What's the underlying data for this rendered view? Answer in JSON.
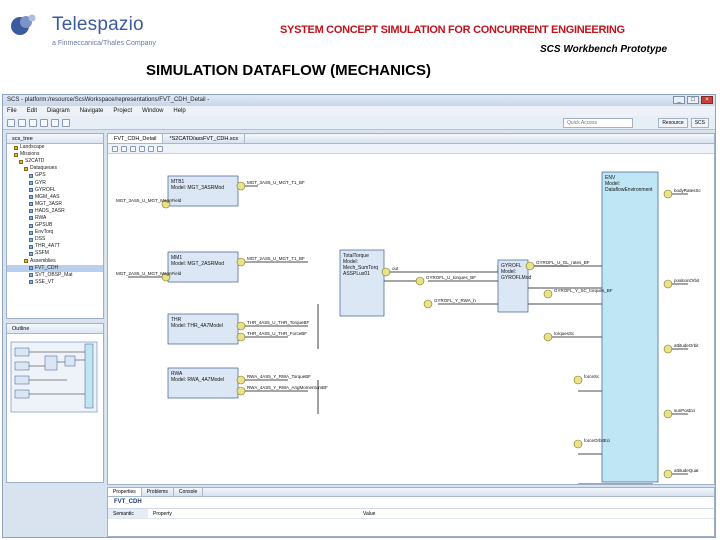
{
  "header": {
    "brand": "Telespazio",
    "brand_sub": "a Finmeccanica/Thales Company",
    "title": "SYSTEM CONCEPT SIMULATION FOR CONCURRENT ENGINEERING",
    "subtitle": "SCS Workbench Prototype",
    "slide_title": "SIMULATION DATAFLOW (MECHANICS)",
    "brand_color": "#3c5aa0",
    "title_color": "#c0121c"
  },
  "window": {
    "title": "SCS - platform:/resource/ScsWorkspace/representations/FVT_CDH_Detail -",
    "menu": [
      "File",
      "Edit",
      "Diagram",
      "Navigate",
      "Project",
      "Window",
      "Help"
    ],
    "quick_access": "Quick Access",
    "perspectives": [
      "Resource",
      "SCS"
    ]
  },
  "tree_panel": {
    "tab": "scs_tree",
    "items": [
      {
        "label": "Landscape",
        "depth": 1,
        "leaf": false
      },
      {
        "label": "Missions",
        "depth": 1,
        "leaf": false
      },
      {
        "label": "S2CATD",
        "depth": 2,
        "leaf": false
      },
      {
        "label": "Dataqueues",
        "depth": 3,
        "leaf": false
      },
      {
        "label": "GPS",
        "depth": 4,
        "leaf": true
      },
      {
        "label": "GYR",
        "depth": 4,
        "leaf": true
      },
      {
        "label": "GYROFL",
        "depth": 4,
        "leaf": true
      },
      {
        "label": "MGM_4AS",
        "depth": 4,
        "leaf": true
      },
      {
        "label": "MGT_3ASR",
        "depth": 4,
        "leaf": true
      },
      {
        "label": "HADS_2ASR",
        "depth": 4,
        "leaf": true
      },
      {
        "label": "RWA",
        "depth": 4,
        "leaf": true
      },
      {
        "label": "GPSUB",
        "depth": 4,
        "leaf": true
      },
      {
        "label": "EnvTorq",
        "depth": 4,
        "leaf": true
      },
      {
        "label": "DSS",
        "depth": 4,
        "leaf": true
      },
      {
        "label": "THR_4A7T",
        "depth": 4,
        "leaf": true
      },
      {
        "label": "SSFM",
        "depth": 4,
        "leaf": true
      },
      {
        "label": "Assemblies",
        "depth": 3,
        "leaf": false
      },
      {
        "label": "FVT_CDH",
        "depth": 4,
        "leaf": true,
        "selected": true
      },
      {
        "label": "SVT_OBSP_Mat",
        "depth": 4,
        "leaf": true
      },
      {
        "label": "SSE_VT",
        "depth": 4,
        "leaf": true
      }
    ]
  },
  "outline_panel": {
    "tab": "Outline"
  },
  "editor": {
    "tabs": [
      "FVT_CDH_Detail",
      "*S2CATD/assFVT_CDH.scs"
    ],
    "active_tab": 0
  },
  "diagram": {
    "blocks": [
      {
        "id": "mtb",
        "lines": [
          "MTB1",
          "Model: MGT_3ASRMod"
        ]
      },
      {
        "id": "mgm",
        "lines": [
          "MM1",
          "Model: MGT_2ASRMod"
        ]
      },
      {
        "id": "thr",
        "lines": [
          "THR",
          "Model: THR_4A7Model"
        ]
      },
      {
        "id": "rwa",
        "lines": [
          "RWA",
          "Model: RWA_4A7Model"
        ]
      },
      {
        "id": "total",
        "lines": [
          "TotalTorque",
          "Model:",
          "Mech_SumTorq",
          "ASSPLus01"
        ]
      },
      {
        "id": "gyro",
        "lines": [
          "GYROFL",
          "Model:",
          "GYROFLMod"
        ]
      },
      {
        "id": "env",
        "lines": [
          "ENV",
          "Model:",
          "DataflowEnvironment"
        ]
      }
    ],
    "ports": {
      "mtb_out": "MGT_3AS5_U_MGT_T1_BF",
      "mtb_in": "MGT_3AS5_U_MGT_MagnField",
      "mgm_out": "MGT_2AS5_U_MGT_T1_BF",
      "mgm_in": "MGT_2AS5_U_MGT_MagnField",
      "thr_out": "THR_4AS5_U_THR_TorqueBF",
      "thr_out2": "THR_4AS5_U_THR_ForceBF",
      "rwa_out": "RWA_4AS5_Y_RWA_TorqueBF",
      "rwa_out2": "RWA_4AS5_Y_RWA_AngMomentumBF",
      "total_out": "out",
      "gyro_out1": "GYROFL_U_GL_rates_BF",
      "gyro_in1": "GYROFL_U_torques_BF",
      "gyro_in2": "GYROFL_Y_RWA_h",
      "gyro_out2": "GYROFL_Y_SC_torques_BF",
      "env_in1": "bodyRatesSc",
      "env_in2": "torquesSc",
      "env_in3": "positionOrbit",
      "env_in4": "forceSc",
      "env_in5": "attitudeOrbit",
      "env_in6": "sunPosEci",
      "env_in7": "forceOrbitEci",
      "env_in8": "attitudeQuat"
    }
  },
  "properties": {
    "tabs": [
      "Properties",
      "Problems",
      "Console"
    ],
    "name": "FVT_CDH",
    "category": "Semantic",
    "col_property": "Property",
    "col_value": "Value"
  }
}
